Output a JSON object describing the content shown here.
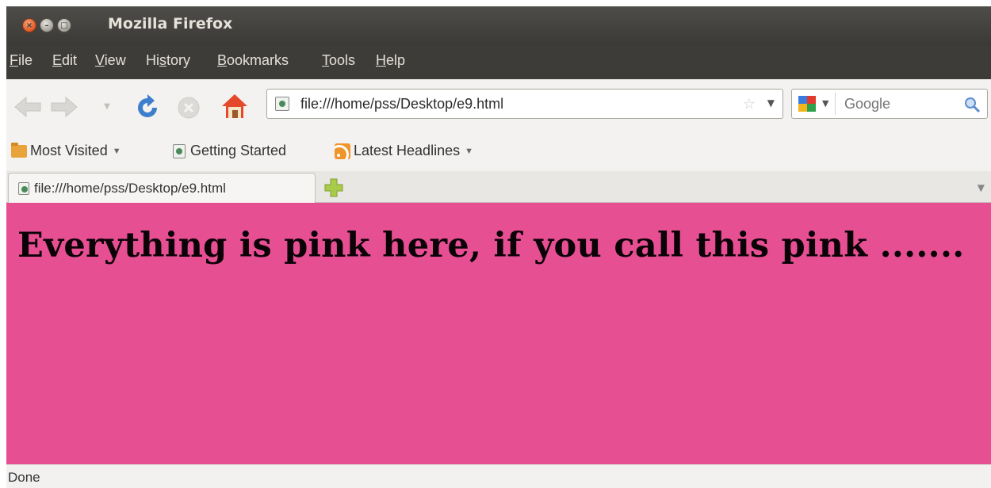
{
  "window": {
    "title": "Mozilla Firefox"
  },
  "menu": {
    "items": [
      {
        "label": "File"
      },
      {
        "label": "Edit"
      },
      {
        "label": "View"
      },
      {
        "label": "History"
      },
      {
        "label": "Bookmarks"
      },
      {
        "label": "Tools"
      },
      {
        "label": "Help"
      }
    ]
  },
  "navigation": {
    "url": "file:///home/pss/Desktop/e9.html",
    "search_placeholder": "Google",
    "icons": [
      "back-icon",
      "forward-icon",
      "history-dropdown-icon",
      "reload-icon",
      "stop-icon",
      "home-icon",
      "bookmark-star-icon",
      "search-engine-icon",
      "magnifier-icon"
    ]
  },
  "bookmarks": {
    "items": [
      {
        "label": "Most Visited",
        "icon": "folder-icon",
        "has_dropdown": true
      },
      {
        "label": "Getting Started",
        "icon": "page-icon",
        "has_dropdown": false
      },
      {
        "label": "Latest Headlines",
        "icon": "rss-icon",
        "has_dropdown": true
      }
    ]
  },
  "tabs": {
    "items": [
      {
        "label": "file:///home/pss/Desktop/e9.html",
        "active": true
      }
    ]
  },
  "content": {
    "background_color": "#e64f91",
    "heading": "Everything is pink here, if you call this pink ......."
  },
  "status": {
    "text": "Done"
  }
}
